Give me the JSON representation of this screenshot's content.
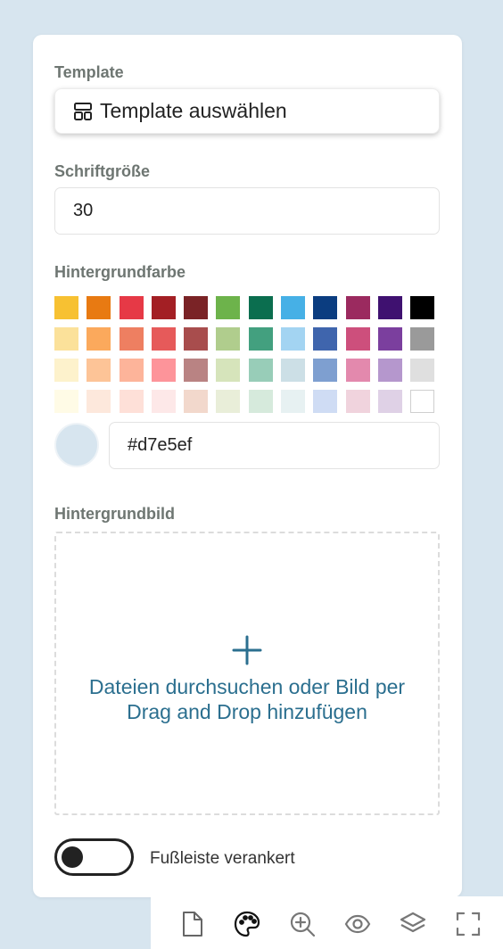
{
  "template": {
    "label": "Template",
    "button_label": "Template auswählen",
    "button_icon": "template-icon"
  },
  "font_size": {
    "label": "Schriftgröße",
    "value": "30"
  },
  "background_color": {
    "label": "Hintergrundfarbe",
    "swatch_rows": [
      [
        "#f7c132",
        "#e87a12",
        "#e63946",
        "#a31f24",
        "#7a2326",
        "#6db34b",
        "#0b6e4f",
        "#46b0e6",
        "#0b3d80",
        "#9b2a5f",
        "#3f1170",
        "#000000"
      ],
      [
        "#fbe19a",
        "#fba95c",
        "#ee7f61",
        "#e65a5a",
        "#a84d4d",
        "#b0cd8d",
        "#43a07f",
        "#a3d4f2",
        "#3f65ad",
        "#cd4f7c",
        "#7b3f9e",
        "#9a9a9a"
      ],
      [
        "#fdf2cc",
        "#fdc497",
        "#fdb49a",
        "#fd949a",
        "#b98383",
        "#d6e4bb",
        "#98cdb8",
        "#ccdfe6",
        "#7e9fd0",
        "#e389ad",
        "#b597cd",
        "#dfdfdf"
      ],
      [
        "#fffbe6",
        "#fde8dc",
        "#fee0d8",
        "#fde8e8",
        "#f2d8cc",
        "#e9eed9",
        "#d6eadc",
        "#e7f1f2",
        "#cfdcf4",
        "#f0d3dd",
        "#dfd1e6",
        "#ffffff"
      ]
    ],
    "hex_value": "#d7e5ef",
    "preview_color": "#d7e5ef"
  },
  "background_image": {
    "label": "Hintergrundbild",
    "dropzone_text": "Dateien durchsuchen oder Bild per Drag and Drop hinzufügen",
    "dropzone_icon": "plus-icon"
  },
  "footer_toggle": {
    "label": "Fußleiste verankert",
    "state": "off"
  },
  "toolbar": {
    "icons": [
      "page-icon",
      "palette-icon",
      "zoom-in-icon",
      "eye-icon",
      "layers-icon",
      "fullscreen-icon"
    ]
  },
  "colors": {
    "page_background": "#d7e5ef",
    "accent": "#2b6f8f",
    "label_text": "#6e7672"
  }
}
